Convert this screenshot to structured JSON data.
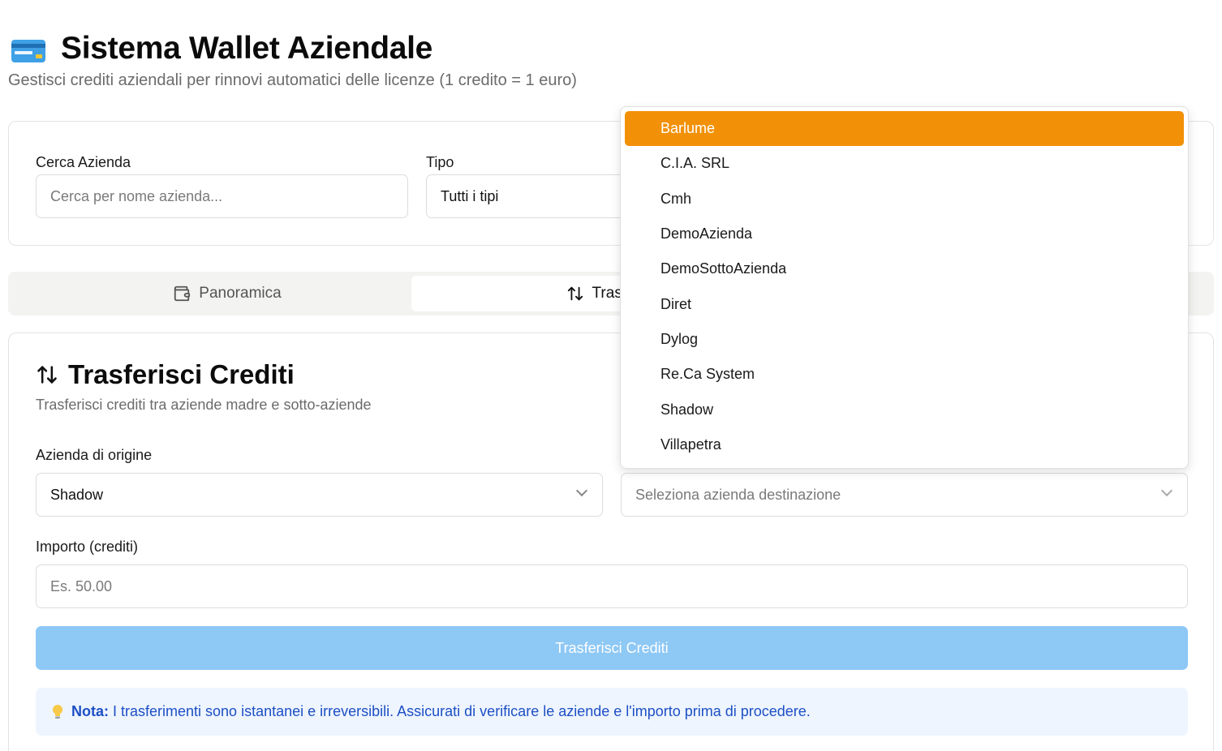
{
  "header": {
    "title": "Sistema Wallet Aziendale",
    "subtitle": "Gestisci crediti aziendali per rinnovi automatici delle licenze (1 credito = 1 euro)",
    "icon": "credit-card-icon"
  },
  "filters": {
    "search_label": "Cerca Azienda",
    "search_placeholder": "Cerca per nome azienda...",
    "type_label": "Tipo",
    "type_value": "Tutti i tipi"
  },
  "tabs": [
    {
      "label": "Panoramica",
      "icon": "wallet-icon",
      "active": false
    },
    {
      "label": "Trasferisci",
      "icon": "arrows-up-down-icon",
      "active": true
    }
  ],
  "transfer": {
    "title": "Trasferisci Crediti",
    "subtitle": "Trasferisci crediti tra aziende madre e sotto-aziende",
    "origin_label": "Azienda di origine",
    "origin_value": "Shadow",
    "destination_placeholder": "Seleziona azienda destinazione",
    "amount_label": "Importo (crediti)",
    "amount_placeholder": "Es. 50.00",
    "submit_label": "Trasferisci Crediti",
    "note_prefix": "Nota:",
    "note_text": " I trasferimenti sono istantanei e irreversibili. Assicurati di verificare le aziende e l'importo prima di procedere."
  },
  "dropdown": {
    "items": [
      "Barlume",
      "C.I.A. SRL",
      "Cmh",
      "DemoAzienda",
      "DemoSottoAzienda",
      "Diret",
      "Dylog",
      "Re.Ca System",
      "Shadow",
      "Villapetra"
    ],
    "highlighted": "Barlume"
  },
  "colors": {
    "accent": "#f29108",
    "button_disabled": "#8ec8f5",
    "note_bg": "#eef5ff",
    "note_text": "#1d4fc4"
  }
}
